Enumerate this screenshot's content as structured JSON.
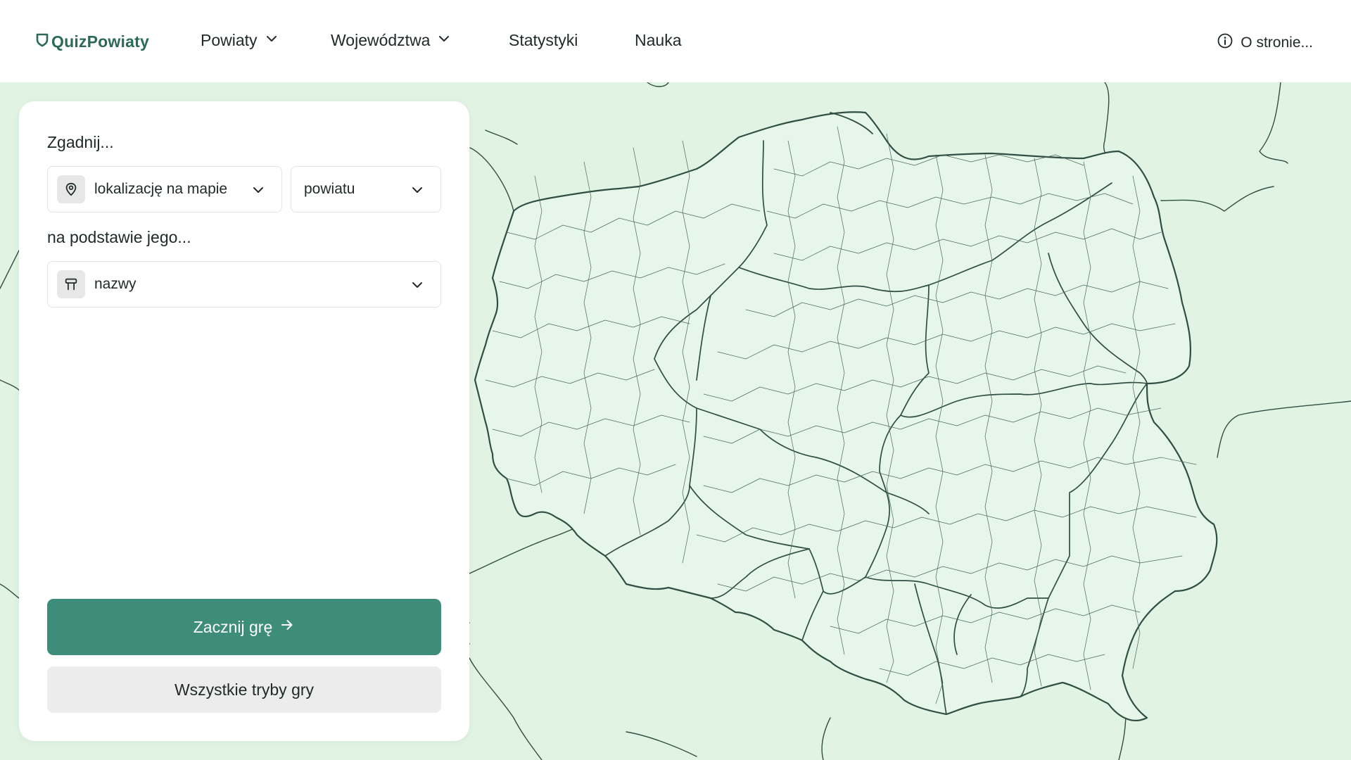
{
  "brand": {
    "name": "QuizPowiaty",
    "logo_icon": "shield-icon",
    "color": "#2b6a56"
  },
  "nav": {
    "items": [
      {
        "label": "Powiaty",
        "has_dropdown": true
      },
      {
        "label": "Województwa",
        "has_dropdown": true
      },
      {
        "label": "Statystyki",
        "has_dropdown": false
      },
      {
        "label": "Nauka",
        "has_dropdown": false
      }
    ],
    "about_label": "O stronie...",
    "about_icon": "info-icon"
  },
  "panel": {
    "guess_label": "Zgadnij...",
    "target_select": {
      "value": "lokalizację na mapie",
      "icon": "map-pin-icon"
    },
    "unit_select": {
      "value": "powiatu"
    },
    "based_label": "na podstawie jego...",
    "hint_select": {
      "value": "nazwy",
      "icon": "signpost-icon"
    },
    "start_button": "Zacznij grę",
    "all_modes_button": "Wszystkie tryby gry"
  },
  "colors": {
    "accent": "#3e8d7a",
    "map_background": "#e1f3e3",
    "map_border": "#2f4f44"
  }
}
